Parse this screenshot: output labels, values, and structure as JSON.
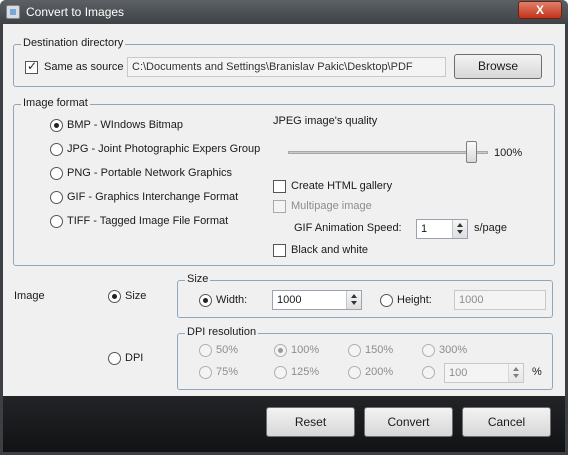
{
  "window": {
    "title": "Convert to Images",
    "close_glyph": "X"
  },
  "destination": {
    "legend": "Destination directory",
    "same_as_source_label": "Same as source",
    "same_as_source_checked": true,
    "path_value": "C:\\Documents and Settings\\Branislav Pakic\\Desktop\\PDF",
    "browse_label": "Browse"
  },
  "image_format": {
    "legend": "Image format",
    "formats": [
      {
        "label": "BMP - WIndows Bitmap",
        "selected": true
      },
      {
        "label": "JPG - Joint Photographic Expers Group",
        "selected": false
      },
      {
        "label": "PNG - Portable Network Graphics",
        "selected": false
      },
      {
        "label": "GIF - Graphics Interchange Format",
        "selected": false
      },
      {
        "label": "TIFF - Tagged Image File Format",
        "selected": false
      }
    ],
    "jpeg_quality_label": "JPEG image's quality",
    "jpeg_quality_value": "100%",
    "jpeg_quality_fraction": 1.0,
    "create_html_gallery_label": "Create HTML gallery",
    "multipage_label": "Multipage image",
    "gif_speed_label": "GIF Animation Speed:",
    "gif_speed_value": "1",
    "gif_speed_unit": "s/page",
    "black_white_label": "Black and white"
  },
  "image": {
    "label": "Image",
    "size_label": "Size",
    "dpi_label": "DPI",
    "size_group": {
      "legend": "Size",
      "width_label": "Width:",
      "width_value": "1000",
      "height_label": "Height:",
      "height_value": "1000"
    },
    "dpi_group": {
      "legend": "DPI resolution",
      "options": [
        "50%",
        "100%",
        "150%",
        "300%",
        "75%",
        "125%",
        "200%"
      ],
      "selected": "100%",
      "custom_value": "100",
      "percent_sign": "%"
    }
  },
  "footer": {
    "reset_label": "Reset",
    "convert_label": "Convert",
    "cancel_label": "Cancel"
  }
}
